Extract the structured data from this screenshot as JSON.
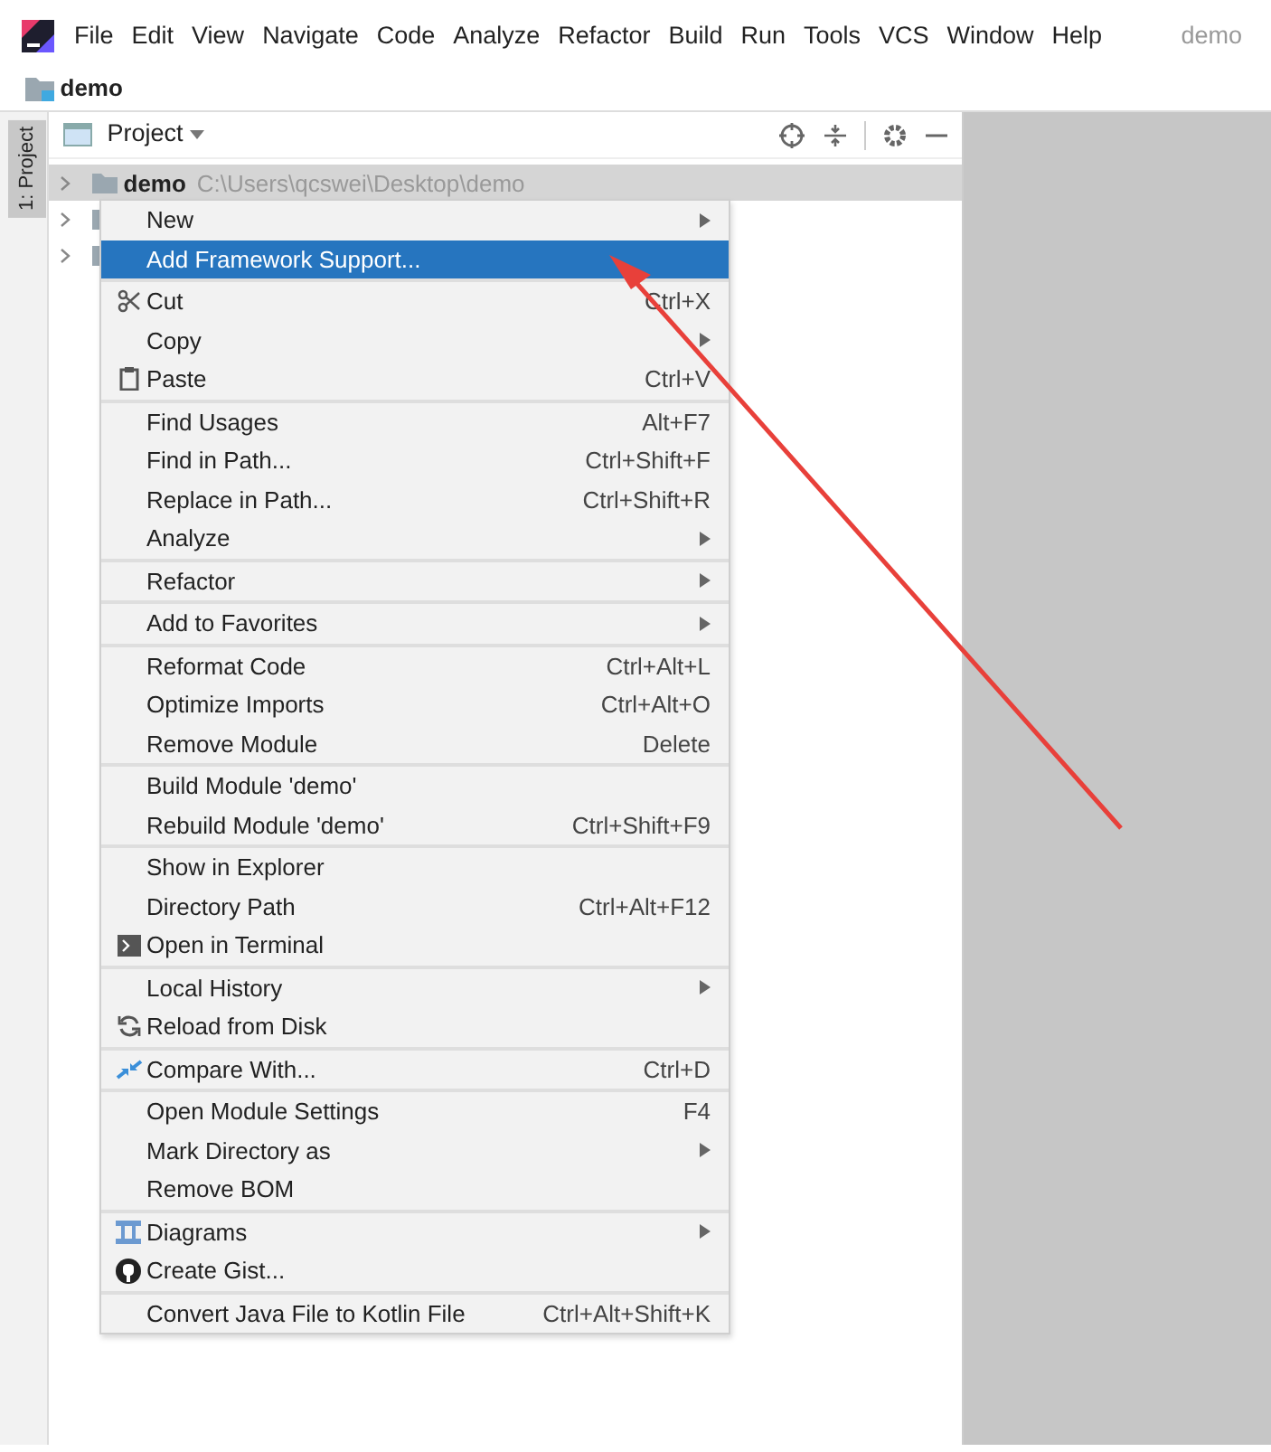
{
  "menu_bar": {
    "items": [
      "File",
      "Edit",
      "View",
      "Navigate",
      "Code",
      "Analyze",
      "Refactor",
      "Build",
      "Run",
      "Tools",
      "VCS",
      "Window",
      "Help"
    ],
    "project_name": "demo"
  },
  "breadcrumb": {
    "label": "demo"
  },
  "tool_window_stripe": {
    "label": "1: Project"
  },
  "project_panel": {
    "title": "Project",
    "tree": [
      {
        "label": "demo",
        "path": "C:\\Users\\qcswei\\Desktop\\demo",
        "selected": true
      },
      {
        "selected": false
      },
      {
        "selected": false
      }
    ]
  },
  "context_menu": {
    "groups": [
      [
        {
          "label": "New",
          "submenu": true,
          "selected": false
        },
        {
          "label": "Add Framework Support...",
          "submenu": false,
          "selected": true
        }
      ],
      [
        {
          "label": "Cut",
          "shortcut": "Ctrl+X",
          "submenu": false,
          "selected": false
        },
        {
          "label": "Copy",
          "submenu": true,
          "selected": false
        },
        {
          "label": "Paste",
          "shortcut": "Ctrl+V",
          "submenu": false,
          "selected": false
        }
      ],
      [
        {
          "label": "Find Usages",
          "shortcut": "Alt+F7",
          "submenu": false,
          "selected": false
        },
        {
          "label": "Find in Path...",
          "shortcut": "Ctrl+Shift+F",
          "submenu": false,
          "selected": false
        },
        {
          "label": "Replace in Path...",
          "shortcut": "Ctrl+Shift+R",
          "submenu": false,
          "selected": false
        },
        {
          "label": "Analyze",
          "submenu": true,
          "selected": false
        }
      ],
      [
        {
          "label": "Refactor",
          "submenu": true,
          "selected": false
        }
      ],
      [
        {
          "label": "Add to Favorites",
          "submenu": true,
          "selected": false
        }
      ],
      [
        {
          "label": "Reformat Code",
          "shortcut": "Ctrl+Alt+L",
          "submenu": false,
          "selected": false
        },
        {
          "label": "Optimize Imports",
          "shortcut": "Ctrl+Alt+O",
          "submenu": false,
          "selected": false
        },
        {
          "label": "Remove Module",
          "shortcut": "Delete",
          "submenu": false,
          "selected": false
        }
      ],
      [
        {
          "label": "Build Module 'demo'",
          "submenu": false,
          "selected": false
        },
        {
          "label": "Rebuild Module 'demo'",
          "shortcut": "Ctrl+Shift+F9",
          "submenu": false,
          "selected": false
        }
      ],
      [
        {
          "label": "Show in Explorer",
          "submenu": false,
          "selected": false
        },
        {
          "label": "Directory Path",
          "shortcut": "Ctrl+Alt+F12",
          "submenu": false,
          "selected": false
        },
        {
          "label": "Open in Terminal",
          "submenu": false,
          "selected": false
        }
      ],
      [
        {
          "label": "Local History",
          "submenu": true,
          "selected": false
        },
        {
          "label": "Reload from Disk",
          "submenu": false,
          "selected": false
        }
      ],
      [
        {
          "label": "Compare With...",
          "shortcut": "Ctrl+D",
          "submenu": false,
          "selected": false
        }
      ],
      [
        {
          "label": "Open Module Settings",
          "shortcut": "F4",
          "submenu": false,
          "selected": false
        },
        {
          "label": "Mark Directory as",
          "submenu": true,
          "selected": false
        },
        {
          "label": "Remove BOM",
          "submenu": false,
          "selected": false
        }
      ],
      [
        {
          "label": "Diagrams",
          "submenu": true,
          "selected": false
        },
        {
          "label": "Create Gist...",
          "submenu": false,
          "selected": false
        }
      ],
      [
        {
          "label": "Convert Java File to Kotlin File",
          "shortcut": "Ctrl+Alt+Shift+K",
          "submenu": false,
          "selected": false
        }
      ]
    ]
  }
}
